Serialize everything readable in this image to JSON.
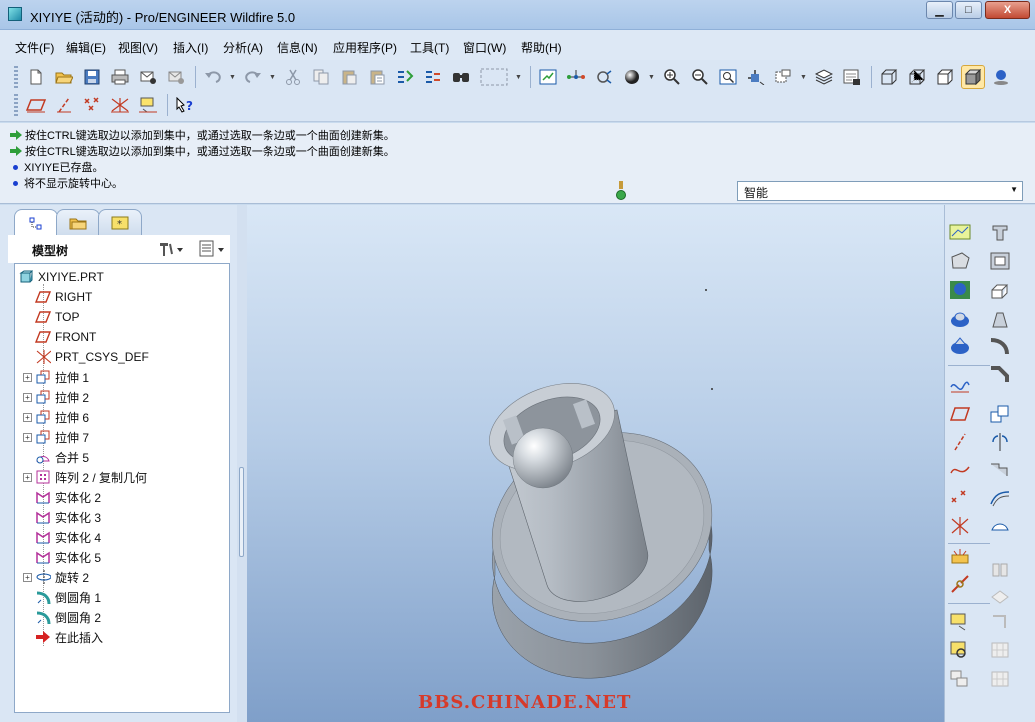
{
  "window": {
    "title": "XIYIYE (活动的) - Pro/ENGINEER Wildfire 5.0",
    "minimize_label": "▁",
    "maximize_label": "□",
    "close_label": "X"
  },
  "menu": [
    "文件(F)",
    "编辑(E)",
    "视图(V)",
    "插入(I)",
    "分析(A)",
    "信息(N)",
    "应用程序(P)",
    "工具(T)",
    "窗口(W)",
    "帮助(H)"
  ],
  "toolbar": {
    "row1": [
      "new-icon",
      "open-icon",
      "save-icon",
      "print-icon",
      "send-mail-icon",
      "send-link-icon",
      "undo-icon",
      "redo-icon",
      "cut-icon",
      "copy-icon",
      "paste-icon",
      "paste-special-icon",
      "regenerate-icon",
      "regen-manager-icon",
      "find-icon",
      "select-box-icon",
      "repaint-icon",
      "spin-center-icon",
      "orient-icon",
      "shade-icon",
      "zoom-in-icon",
      "zoom-out-icon",
      "refit-icon",
      "reorient-icon",
      "saved-views-icon",
      "layers-icon",
      "view-manager-icon",
      "wireframe-icon",
      "hidden-line-icon",
      "no-hidden-icon",
      "shading-icon",
      "enhanced-realism-icon"
    ],
    "row2": [
      "datum-plane-display-icon",
      "datum-axis-display-icon",
      "datum-point-display-icon",
      "csys-display-icon",
      "annotation-display-icon",
      "context-help-icon"
    ]
  },
  "messages": [
    {
      "type": "prompt",
      "text": "按住CTRL键选取边以添加到集中，或通过选取一条边或一个曲面创建新集。"
    },
    {
      "type": "prompt",
      "text": "按住CTRL键选取边以添加到集中，或通过选取一条边或一个曲面创建新集。"
    },
    {
      "type": "info",
      "text": "XIYIYE已存盘。"
    },
    {
      "type": "info",
      "text": "将不显示旋转中心。"
    }
  ],
  "filter": {
    "value": "智能"
  },
  "left_panel": {
    "tabs": [
      "model-tree-tab",
      "folder-browser-tab",
      "favorites-tab"
    ],
    "header_label": "模型树",
    "tree": [
      {
        "label": "XIYIYE.PRT",
        "icon": "part-icon",
        "indent": 0,
        "expand": false
      },
      {
        "label": "RIGHT",
        "icon": "datum-plane-icon",
        "indent": 1,
        "expand": false
      },
      {
        "label": "TOP",
        "icon": "datum-plane-icon",
        "indent": 1,
        "expand": false
      },
      {
        "label": "FRONT",
        "icon": "datum-plane-icon",
        "indent": 1,
        "expand": false
      },
      {
        "label": "PRT_CSYS_DEF",
        "icon": "csys-icon",
        "indent": 1,
        "expand": false
      },
      {
        "label": "拉伸 1",
        "icon": "extrude-icon",
        "indent": 1,
        "expand": true
      },
      {
        "label": "拉伸 2",
        "icon": "extrude-icon",
        "indent": 1,
        "expand": true
      },
      {
        "label": "拉伸 6",
        "icon": "extrude-icon",
        "indent": 1,
        "expand": true
      },
      {
        "label": "拉伸 7",
        "icon": "extrude-icon",
        "indent": 1,
        "expand": true
      },
      {
        "label": "合并 5",
        "icon": "merge-icon",
        "indent": 1,
        "expand": false
      },
      {
        "label": "阵列 2 / 复制几何",
        "icon": "pattern-icon",
        "indent": 1,
        "expand": true
      },
      {
        "label": "实体化 2",
        "icon": "solidify-icon",
        "indent": 1,
        "expand": false
      },
      {
        "label": "实体化 3",
        "icon": "solidify-icon",
        "indent": 1,
        "expand": false
      },
      {
        "label": "实体化 4",
        "icon": "solidify-icon",
        "indent": 1,
        "expand": false
      },
      {
        "label": "实体化 5",
        "icon": "solidify-icon",
        "indent": 1,
        "expand": false
      },
      {
        "label": "旋转 2",
        "icon": "revolve-icon",
        "indent": 1,
        "expand": true
      },
      {
        "label": "倒圆角 1",
        "icon": "round-icon",
        "indent": 1,
        "expand": false
      },
      {
        "label": "倒圆角 2",
        "icon": "round-icon",
        "indent": 1,
        "expand": false
      },
      {
        "label": "在此插入",
        "icon": "insert-here-icon",
        "indent": 1,
        "expand": false
      }
    ]
  },
  "watermark": "BBS.CHINADE.NET",
  "right_toolbar": [
    "datum-plane-tool-icon",
    "hole-icon",
    "datum-axis-tool-icon",
    "shell-icon",
    "datum-point-tool-icon",
    "rib-icon",
    "csys-tool-icon",
    "draft-icon",
    "datum-curve-tool-icon",
    "round-tool-icon",
    "sketch-tool-icon",
    "chamfer-tool-icon"
  ]
}
